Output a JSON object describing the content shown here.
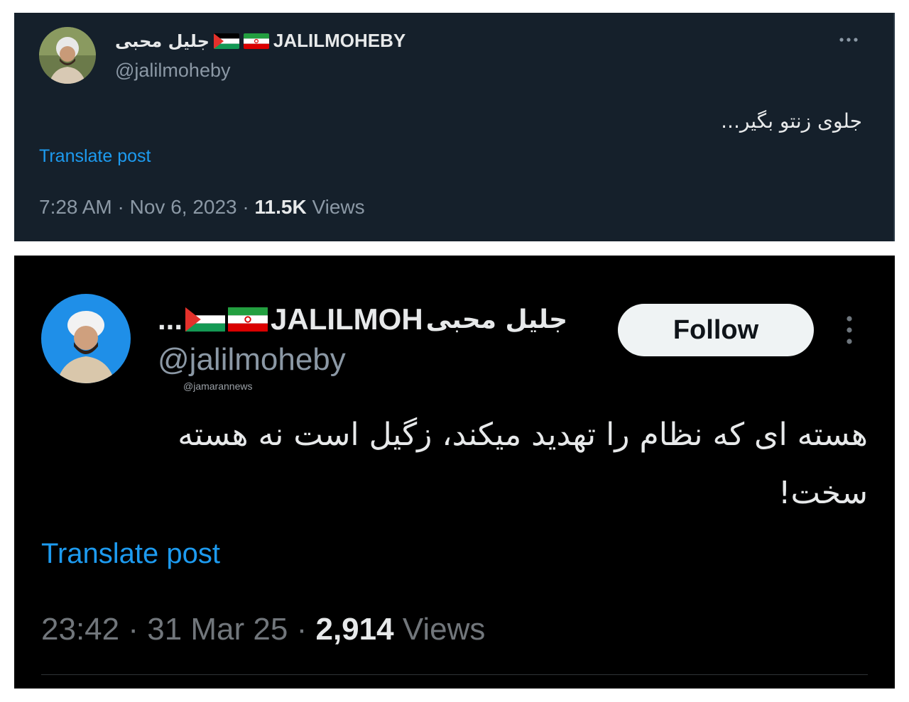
{
  "post_top": {
    "display_name_fa": "جلیل محبی",
    "display_name_en": "JALILMOHEBY",
    "handle": "@jalilmoheby",
    "text": "جلوی زنتو بگیر...",
    "translate_label": "Translate post",
    "time": "7:28 AM",
    "date": "Nov 6, 2023",
    "views_count": "11.5K",
    "views_label": "Views",
    "more_icon": "more-horizontal-icon"
  },
  "post_bottom": {
    "display_name_fa": "جلیل محبی",
    "display_name_en": "JALILMOH",
    "name_ellipsis": "...",
    "handle": "@jalilmoheby",
    "watermark": "@jamarannews",
    "follow_label": "Follow",
    "text": "هسته ای که نظام را تهدید میکند، زگیل است نه هسته سخت!",
    "translate_label": "Translate post",
    "time": "23:42",
    "date": "31 Mar 25",
    "views_count": "2,914",
    "views_label": "Views",
    "more_icon": "more-vertical-icon"
  },
  "colors": {
    "dim_background": "#15202b",
    "black_background": "#000000",
    "link_blue": "#1d9bf0",
    "secondary_text": "#8b98a5",
    "primary_text": "#e7e9ea"
  }
}
